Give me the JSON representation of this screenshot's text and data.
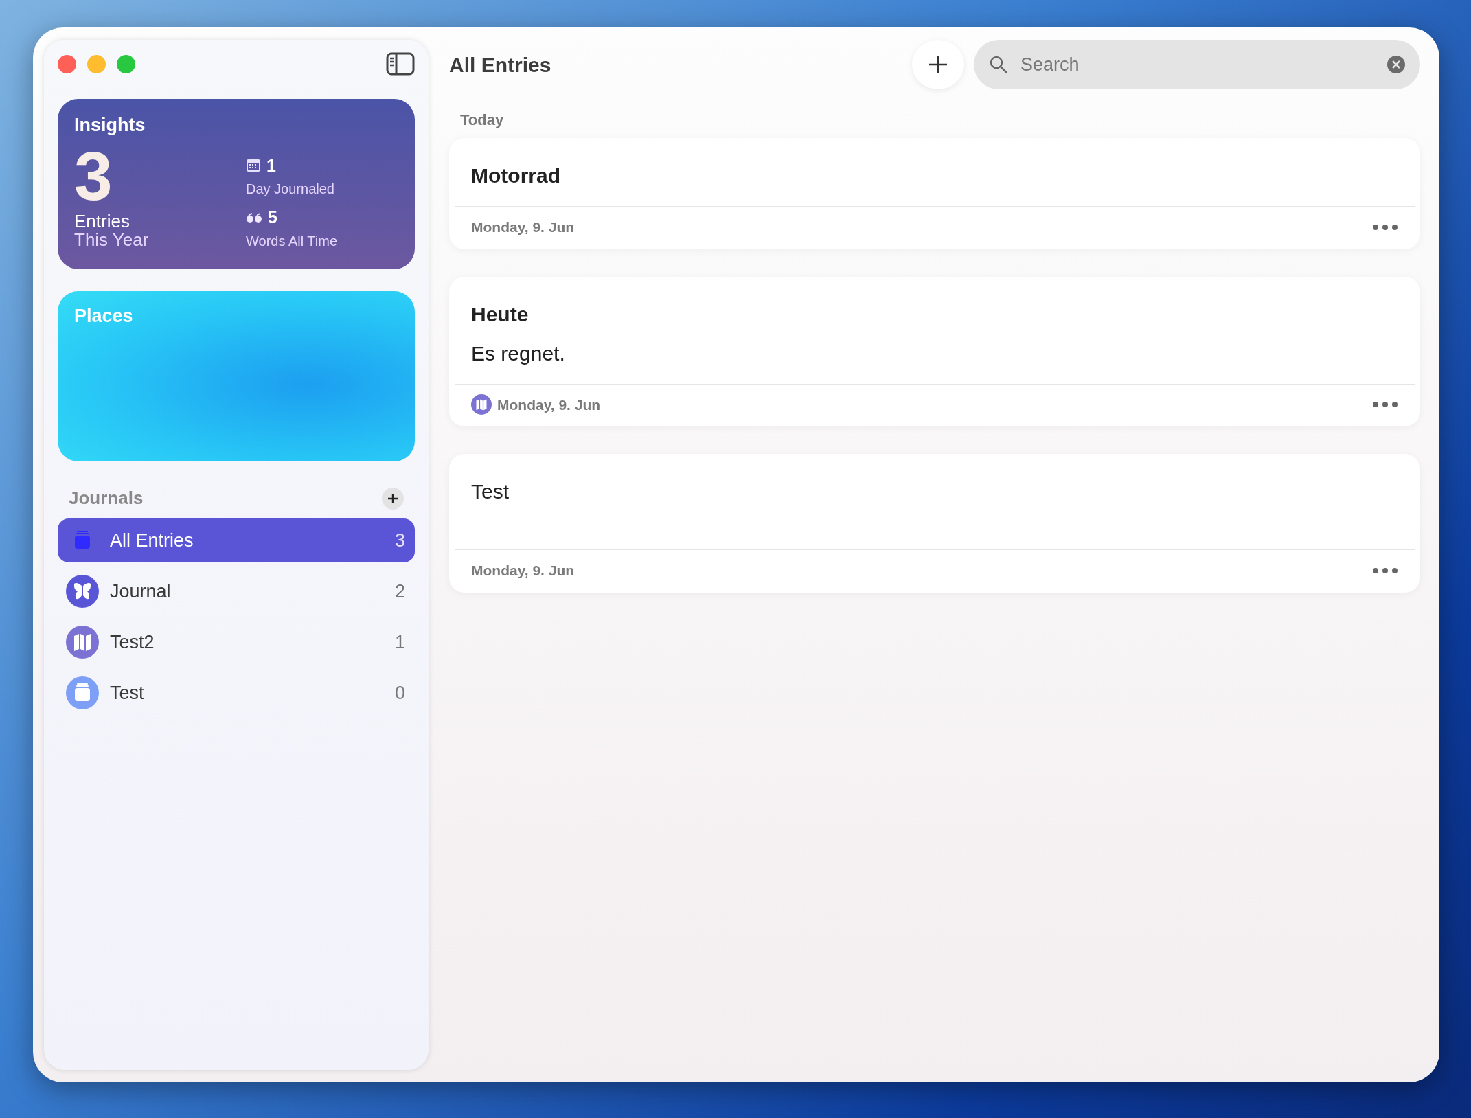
{
  "sidebar": {
    "insights": {
      "title": "Insights",
      "entries_count": "3",
      "entries_label": "Entries",
      "entries_sublabel": "This Year",
      "stats": [
        {
          "kind": "calendar",
          "value": "1",
          "label": "Day Journaled"
        },
        {
          "kind": "quote",
          "value": "5",
          "label": "Words All Time"
        }
      ]
    },
    "places": {
      "title": "Places"
    },
    "journals": {
      "title": "Journals",
      "items": [
        {
          "kind": "stack",
          "name": "All Entries",
          "count": "3",
          "selected": true,
          "color": "#2f2bff"
        },
        {
          "kind": "butterfly",
          "name": "Journal",
          "count": "2",
          "selected": false,
          "color": "#5856d6"
        },
        {
          "kind": "map",
          "name": "Test2",
          "count": "1",
          "selected": false,
          "color": "#7b72d4"
        },
        {
          "kind": "stack",
          "name": "Test",
          "count": "0",
          "selected": false,
          "color": "#7da0f6"
        }
      ]
    }
  },
  "main": {
    "title": "All Entries",
    "search": {
      "placeholder": "Search"
    },
    "section": "Today",
    "entries": [
      {
        "kind": "titled",
        "title": "Motorrad",
        "date": "Monday, 9. Jun"
      },
      {
        "kind": "titled",
        "title": "Heute",
        "body": "Es regnet.",
        "date": "Monday, 9. Jun",
        "journal_badge": true
      },
      {
        "kind": "plain",
        "title": "Test",
        "date": "Monday, 9. Jun"
      }
    ]
  }
}
